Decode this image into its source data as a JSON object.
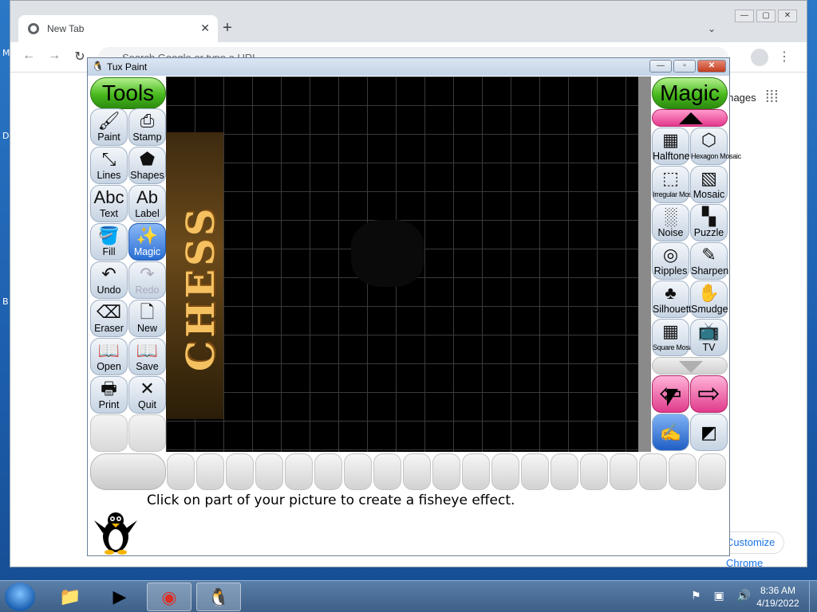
{
  "desktop": {
    "letters": [
      "M",
      "D",
      "B"
    ]
  },
  "chrome": {
    "tab_title": "New Tab",
    "tab_close": "✕",
    "new_tab": "+",
    "tab_dropdown": "⌄",
    "omnibox_placeholder": "Search Google or type a URL",
    "images_link": "Images",
    "customize_label": "Customize Chrome",
    "back": "←",
    "forward": "→",
    "reload": "↻",
    "kebab": "⋮",
    "apps": "⋮⋮⋮",
    "win_min": "—",
    "win_max": "▢",
    "win_close": "✕"
  },
  "tuxpaint": {
    "title": "Tux Paint",
    "title_icon": "🐧",
    "ctrl_min": "—",
    "ctrl_max": "▫",
    "ctrl_close": "✕",
    "tools_header": "Tools",
    "magic_header": "Magic",
    "tools": [
      {
        "label": "Paint",
        "icon": "🖌",
        "state": "normal"
      },
      {
        "label": "Stamp",
        "icon": "⎙",
        "state": "normal"
      },
      {
        "label": "Lines",
        "icon": "⤡",
        "state": "normal"
      },
      {
        "label": "Shapes",
        "icon": "⬟",
        "state": "normal"
      },
      {
        "label": "Text",
        "icon": "Abc",
        "state": "normal"
      },
      {
        "label": "Label",
        "icon": "Ab",
        "state": "normal"
      },
      {
        "label": "Fill",
        "icon": "🪣",
        "state": "normal"
      },
      {
        "label": "Magic",
        "icon": "✨",
        "state": "selected"
      },
      {
        "label": "Undo",
        "icon": "↶",
        "state": "normal"
      },
      {
        "label": "Redo",
        "icon": "↷",
        "state": "disabled"
      },
      {
        "label": "Eraser",
        "icon": "⌫",
        "state": "normal"
      },
      {
        "label": "New",
        "icon": "🗋",
        "state": "normal"
      },
      {
        "label": "Open",
        "icon": "📖",
        "state": "normal"
      },
      {
        "label": "Save",
        "icon": "📖",
        "state": "normal"
      },
      {
        "label": "Print",
        "icon": "🖶",
        "state": "normal"
      },
      {
        "label": "Quit",
        "icon": "✕",
        "state": "normal"
      }
    ],
    "magic": [
      {
        "label": "Halftone",
        "icon": "▦",
        "small": false
      },
      {
        "label": "Hexagon Mosaic",
        "icon": "⬡",
        "small": true
      },
      {
        "label": "Irregular Mosaic",
        "icon": "⬚",
        "small": true
      },
      {
        "label": "Mosaic",
        "icon": "▧",
        "small": false
      },
      {
        "label": "Noise",
        "icon": "░",
        "small": false
      },
      {
        "label": "Puzzle",
        "icon": "▚",
        "small": false
      },
      {
        "label": "Ripples",
        "icon": "◎",
        "small": false
      },
      {
        "label": "Sharpen",
        "icon": "✎",
        "small": false
      },
      {
        "label": "Silhouette",
        "icon": "♣",
        "small": false
      },
      {
        "label": "Smudge",
        "icon": "✋",
        "small": false
      },
      {
        "label": "Square Mosaic",
        "icon": "▦",
        "small": true
      },
      {
        "label": "TV",
        "icon": "📺",
        "small": false
      }
    ],
    "prev_arrow": "⇦",
    "next_arrow": "⇨",
    "canvas_text": "CHESS",
    "status": "Click on part of your picture to create a fisheye effect."
  },
  "taskbar": {
    "apps": [
      {
        "name": "file-explorer",
        "icon": "📁"
      },
      {
        "name": "media-player",
        "icon": "▶"
      },
      {
        "name": "chrome",
        "icon": "◉"
      },
      {
        "name": "tux-paint",
        "icon": "🐧"
      }
    ],
    "tray_icons": "⚑ ▣ 🔊",
    "time": "8:36 AM",
    "date": "4/19/2022"
  },
  "colors": {
    "accent_green": "#48b91d",
    "accent_pink": "#e03b8c",
    "selected_blue": "#2a6fd4"
  }
}
